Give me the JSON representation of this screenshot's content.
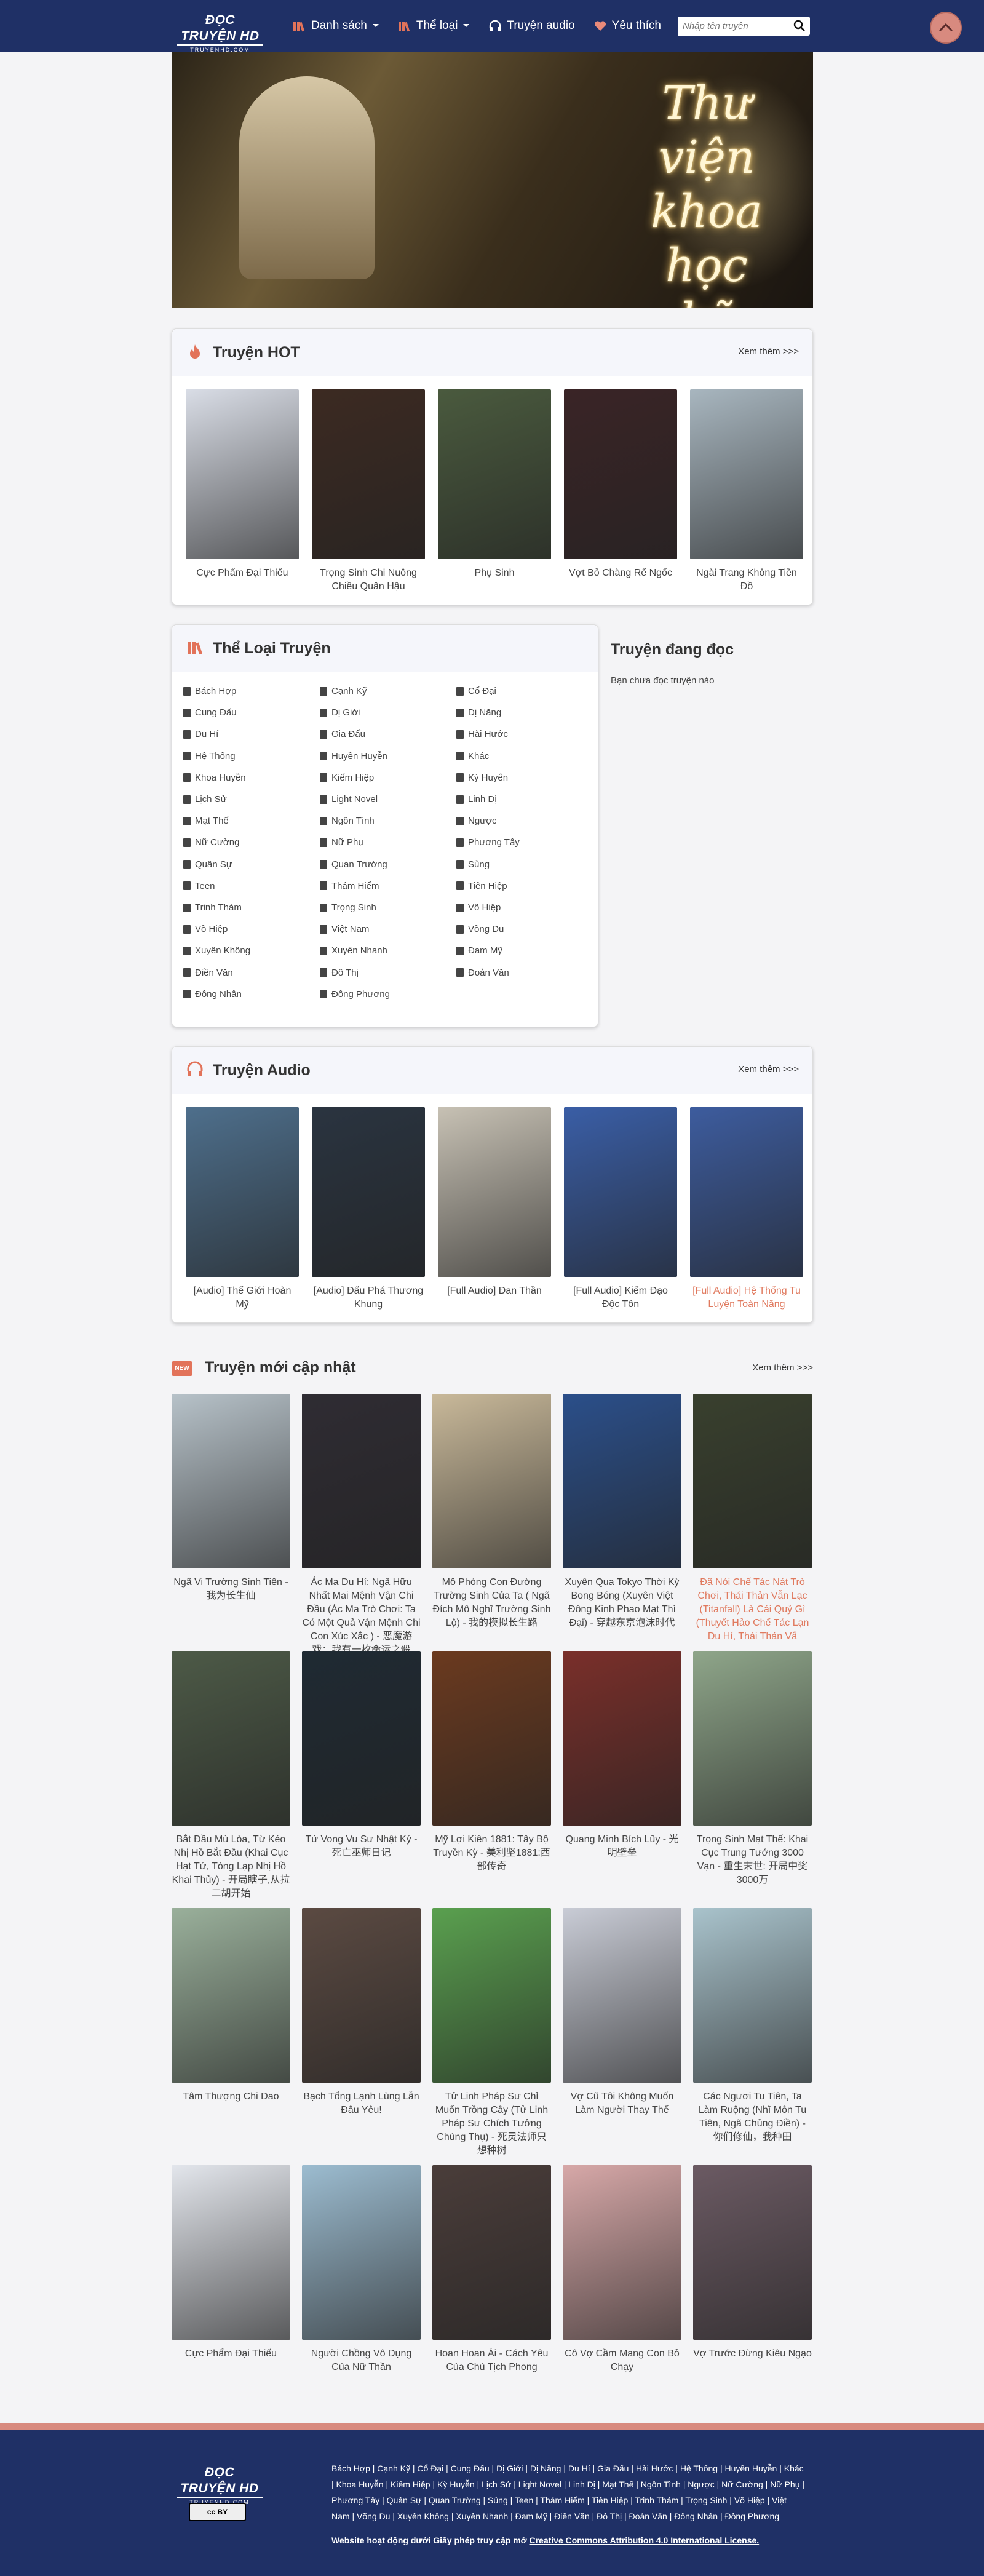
{
  "header": {
    "logo_line1": "ĐỌC TRUYỆN HD",
    "logo_line2": "TRUYENHD.COM",
    "nav": [
      {
        "label": "Danh sách",
        "icon": "books-icon",
        "dropdown": true
      },
      {
        "label": "Thể loại",
        "icon": "books-icon",
        "dropdown": true
      },
      {
        "label": "Truyện audio",
        "icon": "headphones-icon",
        "dropdown": false
      },
      {
        "label": "Yêu thích",
        "icon": "heart-icon",
        "dropdown": false
      }
    ],
    "search_placeholder": "Nhập tên truyện"
  },
  "banner": {
    "text_lines": [
      "Thư viện",
      "khoa học",
      "kỹ thuật"
    ]
  },
  "hot": {
    "title": "Truyện HOT",
    "more": "Xem thêm >>>",
    "books": [
      {
        "title": "Cực Phẩm Đại Thiếu",
        "color": "#d9dde6"
      },
      {
        "title": "Trọng Sinh Chi Nuông Chiều Quân Hậu",
        "color": "#3c2a22"
      },
      {
        "title": "Phụ Sinh",
        "color": "#4a5a3e"
      },
      {
        "title": "Vợt Bỏ Chàng Rể Ngốc",
        "color": "#3a2426"
      },
      {
        "title": "Ngài Trang Không Tiền Đồ",
        "color": "#a8b6bf"
      }
    ]
  },
  "genres": {
    "title": "Thể Loại Truyện",
    "items": [
      "Bách Hợp",
      "Cạnh Kỹ",
      "Cổ Đại",
      "Cung Đấu",
      "Dị Giới",
      "Dị Năng",
      "Du Hí",
      "Gia Đấu",
      "Hài Hước",
      "Hệ Thống",
      "Huyền Huyễn",
      "Khác",
      "Khoa Huyễn",
      "Kiếm Hiệp",
      "Kỳ Huyễn",
      "Lịch Sử",
      "Light Novel",
      "Linh Dị",
      "Mạt Thế",
      "Ngôn Tình",
      "Ngược",
      "Nữ Cường",
      "Nữ Phụ",
      "Phương Tây",
      "Quân Sự",
      "Quan Trường",
      "Sủng",
      "Teen",
      "Thám Hiểm",
      "Tiên Hiệp",
      "Trinh Thám",
      "Trọng Sinh",
      "Võ Hiệp",
      "Võ Hiệp",
      "Việt Nam",
      "Võng Du",
      "Xuyên Không",
      "Xuyên Nhanh",
      "Đam Mỹ",
      "Điền Văn",
      "Đô Thị",
      "Đoản Văn",
      "Đông Nhân",
      "Đông Phương"
    ]
  },
  "reading": {
    "title": "Truyện đang đọc",
    "empty": "Bạn chưa đọc truyện nào"
  },
  "audio": {
    "title": "Truyện Audio",
    "more": "Xem thêm >>>",
    "books": [
      {
        "title": "[Audio] Thế Giới Hoàn Mỹ",
        "color": "#4e6f8c",
        "highlight": false
      },
      {
        "title": "[Audio] Đấu Phá Thương Khung",
        "color": "#2a3440",
        "highlight": false
      },
      {
        "title": "[Full Audio] Đan Thần",
        "color": "#c7c1b4",
        "highlight": false
      },
      {
        "title": "[Full Audio] Kiếm Đạo Độc Tôn",
        "color": "#3a5ea6",
        "highlight": false
      },
      {
        "title": "[Full Audio] Hệ Thống Tu Luyện Toàn Năng",
        "color": "#3d5c9e",
        "highlight": true
      }
    ]
  },
  "new": {
    "badge": "NEW",
    "title": "Truyện mới cập nhật",
    "more": "Xem thêm >>>",
    "books": [
      {
        "title": "Ngã Vi Trường Sinh Tiên - 我为长生仙",
        "color": "#b7c2c9",
        "highlight": false
      },
      {
        "title": "Ác Ma Du Hí: Ngã Hữu Nhất Mai Mệnh Vận Chi Đầu (Ác Ma Trò Chơi: Ta Có Một Quả Vận Mệnh Chi Con Xúc Xắc ) - 恶魔游戏：我有一枚命运之骰",
        "color": "#2f2c33",
        "highlight": false
      },
      {
        "title": "Mô Phỏng Con Đường Trường Sinh Của Ta ( Ngã Đích Mô Nghĩ Trường Sinh Lộ) - 我的模拟长生路",
        "color": "#c9b99a",
        "highlight": false
      },
      {
        "title": "Xuyên Qua Tokyo Thời Kỳ Bong Bóng (Xuyên Việt Đông Kinh Phao Mạt Thì Đại) - 穿越东京泡沫时代",
        "color": "#2b4f8a",
        "highlight": false
      },
      {
        "title": "Đã Nói Chế Tác Nát Trò Chơi, Thái Thản Vẫn Lạc (Titanfall) Là Cái Quỷ Gì (Thuyết Hảo Chế Tác Lạn Du Hí, Thái Thản Vẫ",
        "color": "#39402e",
        "highlight": true
      },
      {
        "title": "Bắt Đầu Mù Lòa, Từ Kéo Nhị Hồ Bắt Đầu (Khai Cục Hạt Tử, Tòng Lạp Nhị Hồ Khai Thủy) - 开局瞎子,从拉二胡开始",
        "color": "#4d5a47",
        "highlight": false
      },
      {
        "title": "Tử Vong Vu Sư Nhật Ký - 死亡巫师日记",
        "color": "#1f2a33",
        "highlight": false
      },
      {
        "title": "Mỹ Lợi Kiên 1881: Tây Bộ Truyền Kỳ - 美利坚1881:西部传奇",
        "color": "#6b3a1f",
        "highlight": false
      },
      {
        "title": "Quang Minh Bích Lũy - 光明壁垒",
        "color": "#7a2f2a",
        "highlight": false
      },
      {
        "title": "Trọng Sinh Mạt Thế: Khai Cục Trung Tướng 3000 Vạn - 重生末世: 开局中奖3000万",
        "color": "#8fa68a",
        "highlight": false
      },
      {
        "title": "Tâm Thượng Chi Dao",
        "color": "#9ab09b",
        "highlight": false
      },
      {
        "title": "Bạch Tổng Lạnh Lùng Lẫn Đâu Yêu!",
        "color": "#5b4a42",
        "highlight": false
      },
      {
        "title": "Tử Linh Pháp Sư Chỉ Muốn Trồng Cây (Tử Linh Pháp Sư Chích Tưởng Chủng Thụ) - 死灵法师只想种树",
        "color": "#5aa04f",
        "highlight": false
      },
      {
        "title": "Vợ Cũ Tôi Không Muốn Làm Người Thay Thế",
        "color": "#c9ccd6",
        "highlight": false
      },
      {
        "title": "Các Ngươi Tu Tiên, Ta Làm Ruộng (Nhĩ Môn Tu Tiên, Ngã Chủng Điền) - 你们修仙，我种田",
        "color": "#a9c3cc",
        "highlight": false
      },
      {
        "title": "Cực Phẩm Đại Thiếu",
        "color": "#e3e6ec",
        "highlight": false
      },
      {
        "title": "Người Chồng Vô Dụng Của Nữ Thần",
        "color": "#9cbcd0",
        "highlight": false
      },
      {
        "title": "Hoan Hoan Ái - Cách Yêu Của Chủ Tịch Phong",
        "color": "#4a3d3a",
        "highlight": false
      },
      {
        "title": "Cô Vợ Cầm Mang Con Bỏ Chạy",
        "color": "#d7a8a8",
        "highlight": false
      },
      {
        "title": "Vợ Trước Đừng Kiêu Ngạo",
        "color": "#6b5a63",
        "highlight": false
      }
    ]
  },
  "footer": {
    "logo_line1": "ĐỌC TRUYỆN HD",
    "logo_line2": "TRUYENHD.COM",
    "cc_label": "cc BY",
    "links_text": "Bách Hợp | Cạnh Kỹ | Cổ Đại | Cung Đấu | Dị Giới | Dị Năng | Du Hí | Gia Đấu | Hài Hước | Hệ Thống | Huyền Huyễn | Khác | Khoa Huyễn | Kiếm Hiệp | Kỳ Huyễn | Lịch Sử | Light Novel | Linh Dị | Mạt Thế | Ngôn Tình | Ngược | Nữ Cường | Nữ Phụ | Phương Tây | Quân Sự | Quan Trường | Sủng | Teen | Thám Hiểm | Tiên Hiệp | Trinh Thám | Trọng Sinh | Võ Hiệp | Việt Nam | Võng Du | Xuyên Không | Xuyên Nhanh | Đam Mỹ | Điền Văn | Đô Thị | Đoản Văn | Đông Nhân | Đông Phương",
    "license_prefix": "Website hoạt động dưới Giấy phép truy cập mở ",
    "license_link": "Creative Commons Attribution 4.0 International License."
  },
  "colors": {
    "header": "#1f3066",
    "accent": "#d88a7f",
    "highlight_text": "#e07a5f"
  }
}
